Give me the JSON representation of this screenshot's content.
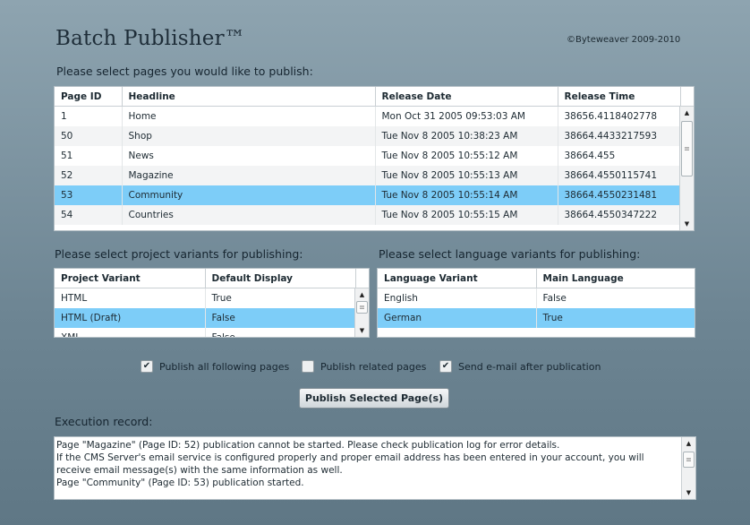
{
  "app": {
    "title": "Batch Publisher™",
    "copyright": "©Byteweaver 2009-2010"
  },
  "pages": {
    "label": "Please select pages you would like to publish:",
    "columns": [
      "Page ID",
      "Headline",
      "Release Date",
      "Release Time"
    ],
    "rows": [
      [
        "1",
        "Home",
        "Mon Oct 31 2005 09:53:03 AM",
        "38656.4118402778"
      ],
      [
        "50",
        "Shop",
        "Tue Nov 8 2005 10:38:23 AM",
        "38664.4433217593"
      ],
      [
        "51",
        "News",
        "Tue Nov 8 2005 10:55:12 AM",
        "38664.455"
      ],
      [
        "52",
        "Magazine",
        "Tue Nov 8 2005 10:55:13 AM",
        "38664.4550115741"
      ],
      [
        "53",
        "Community",
        "Tue Nov 8 2005 10:55:14 AM",
        "38664.4550231481"
      ],
      [
        "54",
        "Countries",
        "Tue Nov 8 2005 10:55:15 AM",
        "38664.4550347222"
      ]
    ],
    "selected_row": 4
  },
  "projects": {
    "label": "Please select project variants for publishing:",
    "columns": [
      "Project Variant",
      "Default Display"
    ],
    "rows": [
      [
        "HTML",
        "True"
      ],
      [
        "HTML (Draft)",
        "False"
      ],
      [
        "XML",
        "False"
      ]
    ],
    "selected_row": 1
  },
  "languages": {
    "label": "Please select language variants for publishing:",
    "columns": [
      "Language Variant",
      "Main Language"
    ],
    "rows": [
      [
        "English",
        "False"
      ],
      [
        "German",
        "True"
      ]
    ],
    "selected_row": 1
  },
  "options": {
    "publish_following": {
      "label": "Publish all following pages",
      "checked": true
    },
    "publish_related": {
      "label": "Publish related pages",
      "checked": false
    },
    "send_email": {
      "label": "Send e-mail after publication",
      "checked": true
    }
  },
  "publish_button": "Publish Selected Page(s)",
  "execution": {
    "label": "Execution record:",
    "text": "Page \"Magazine\" (Page ID: 52) publication cannot be started. Please check publication log for error details.\nIf the CMS Server's email service is configured properly and proper email address has been entered in your account, you will receive email message(s) with the same information as well.\nPage \"Community\" (Page ID: 53) publication started."
  },
  "icons": {
    "scroll_up": "arrow-up-icon",
    "scroll_down": "arrow-down-icon",
    "check": "check-icon"
  }
}
